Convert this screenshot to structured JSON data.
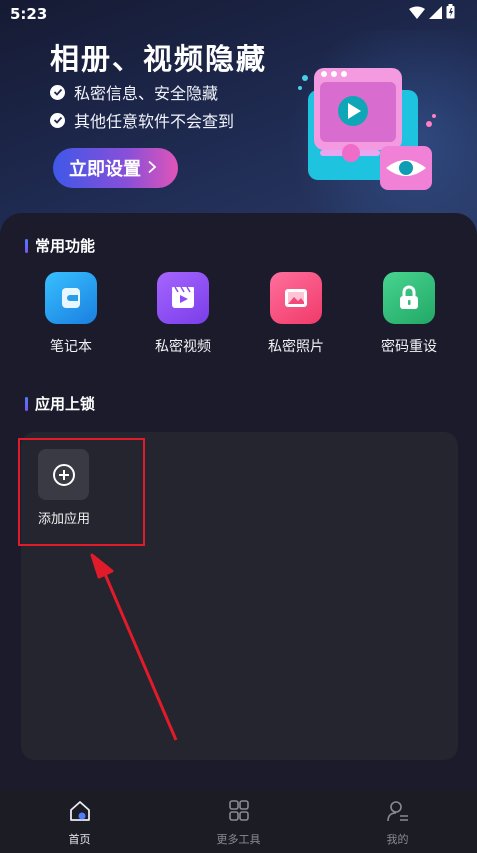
{
  "status_bar": {
    "time": "5:23"
  },
  "hero": {
    "title": "相册、视频隐藏",
    "bullets": [
      "私密信息、安全隐藏",
      "其他任意软件不会查到"
    ],
    "button_label": "立即设置"
  },
  "common_functions": {
    "title": "常用功能",
    "items": [
      {
        "label": "笔记本",
        "icon": "notebook-icon",
        "color": "#2aa6f0"
      },
      {
        "label": "私密视频",
        "icon": "video-icon",
        "color": "#8d4ef0"
      },
      {
        "label": "私密照片",
        "icon": "photo-icon",
        "color": "#f2497a"
      },
      {
        "label": "密码重设",
        "icon": "lock-icon",
        "color": "#2fbf7a"
      }
    ]
  },
  "app_lock": {
    "title": "应用上锁",
    "add_label": "添加应用"
  },
  "tabbar": {
    "tabs": [
      {
        "label": "首页",
        "icon": "home-icon",
        "active": true
      },
      {
        "label": "更多工具",
        "icon": "grid-icon",
        "active": false
      },
      {
        "label": "我的",
        "icon": "profile-icon",
        "active": false
      }
    ]
  },
  "colors": {
    "accent": "#e01b2a",
    "background": "#1b1b2c",
    "card": "#25252f"
  }
}
